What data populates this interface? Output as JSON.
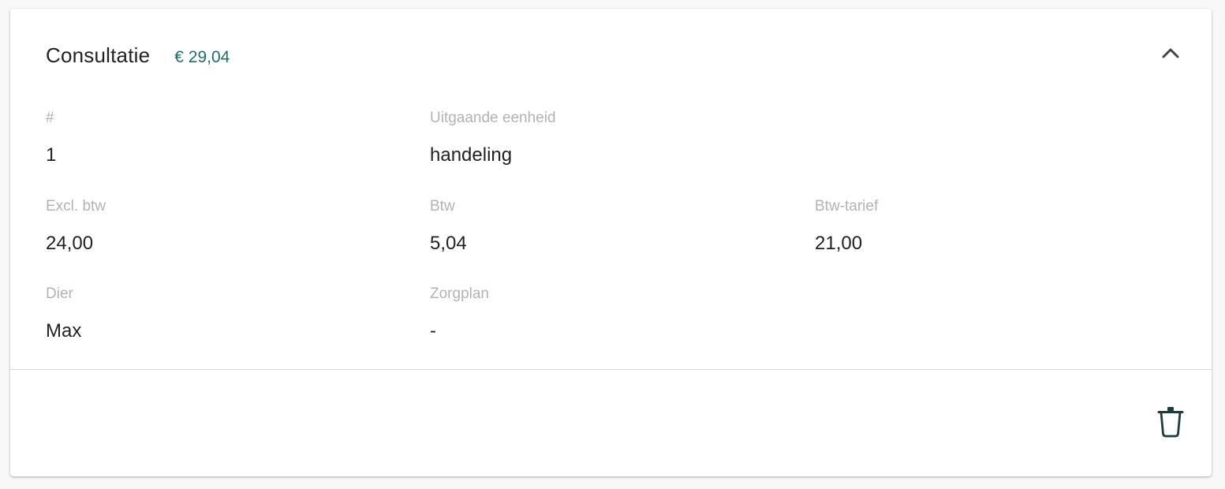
{
  "card": {
    "title": "Consultatie",
    "price": "€ 29,04",
    "fields": {
      "number": {
        "label": "#",
        "value": "1"
      },
      "unit": {
        "label": "Uitgaande eenheid",
        "value": "handeling"
      },
      "excl_vat": {
        "label": "Excl. btw",
        "value": "24,00"
      },
      "vat": {
        "label": "Btw",
        "value": "5,04"
      },
      "vat_rate": {
        "label": "Btw-tarief",
        "value": "21,00"
      },
      "animal": {
        "label": "Dier",
        "value": "Max"
      },
      "care_plan": {
        "label": "Zorgplan",
        "value": "-"
      }
    },
    "icons": {
      "collapse": "chevron-up-icon",
      "delete": "trash-icon"
    },
    "colors": {
      "accent": "#1e6e6a",
      "icon": "#1f3b3a"
    }
  }
}
